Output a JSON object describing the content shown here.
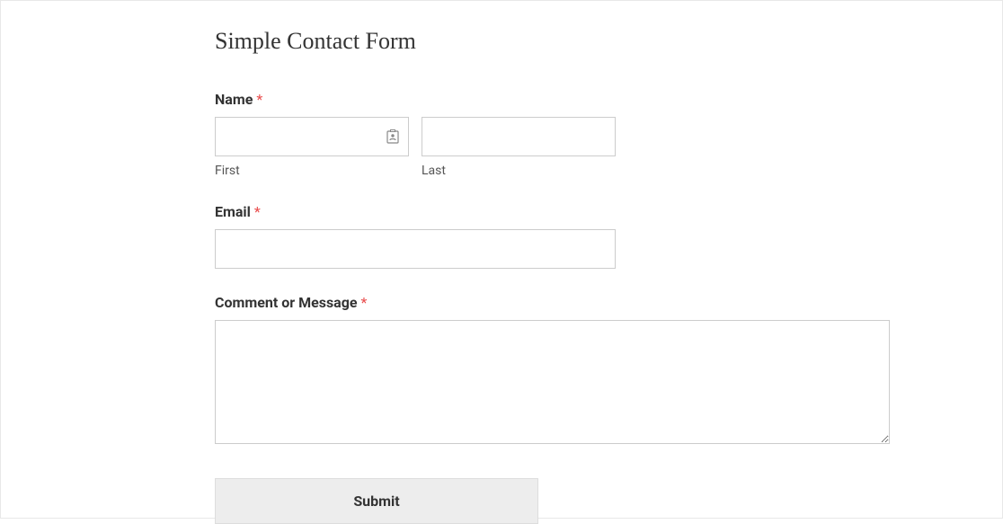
{
  "form": {
    "title": "Simple Contact Form",
    "name": {
      "label": "Name",
      "required_marker": "*",
      "first_sublabel": "First",
      "last_sublabel": "Last",
      "first_value": "",
      "last_value": ""
    },
    "email": {
      "label": "Email",
      "required_marker": "*",
      "value": ""
    },
    "comment": {
      "label": "Comment or Message",
      "required_marker": "*",
      "value": ""
    },
    "submit_label": "Submit"
  }
}
